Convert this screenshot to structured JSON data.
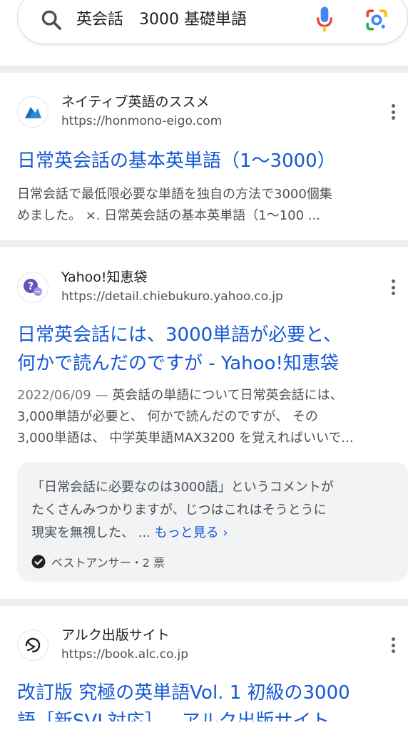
{
  "search": {
    "query": "英会話　3000 基礎単語",
    "icons": {
      "search": "search-icon",
      "mic": "mic-icon",
      "lens": "google-lens-icon"
    }
  },
  "results": [
    {
      "site_name": "ネイティブ英語のススメ",
      "url": "https://honmono-eigo.com",
      "title": "日常英会話の基本英単語（1〜3000）",
      "snippet_lines": [
        "日常会話で最低限必要な単語を独自の方法で3000個集",
        "めました。 ×. 日常英会話の基本英単語（1〜100 ..."
      ],
      "favicon": "blue-mountain-logo"
    },
    {
      "site_name": "Yahoo!知恵袋",
      "url": "https://detail.chiebukuro.yahoo.co.jp",
      "title_lines": [
        "日常英会話には、3000単語が必要と、",
        "何かで読んだのですが - Yahoo!知恵袋"
      ],
      "date": "2022/06/09",
      "date_separator": " — ",
      "snippet_lines": [
        "英会話の単語について日常英会話には、",
        "3,000単語が必要と、 何かで読んだのですが、 その",
        "3,000単語は、 中学英単語MAX3200 を覚えればいいで..."
      ],
      "favicon": "question-bubble-logo",
      "answer": {
        "lines": [
          "「日常会話に必要なのは3000語」というコメントが",
          "たくさんみつかりますが、じつはこれはそうとうに",
          "現実を無視した、 ... "
        ],
        "more_label": "もっと見る ›",
        "best_label": "ベストアンサー・2 票"
      }
    },
    {
      "site_name": "アルク出版サイト",
      "url": "https://book.alc.co.jp",
      "title_lines": [
        "改訂版 究極の英単語Vol. 1 初級の3000",
        "語［新SVL対応］ - アルク出版サイト"
      ],
      "favicon": "alc-logo"
    }
  ],
  "colors": {
    "link": "#1558d6",
    "divider": "#eceff1",
    "card": "#f1f3f4"
  }
}
